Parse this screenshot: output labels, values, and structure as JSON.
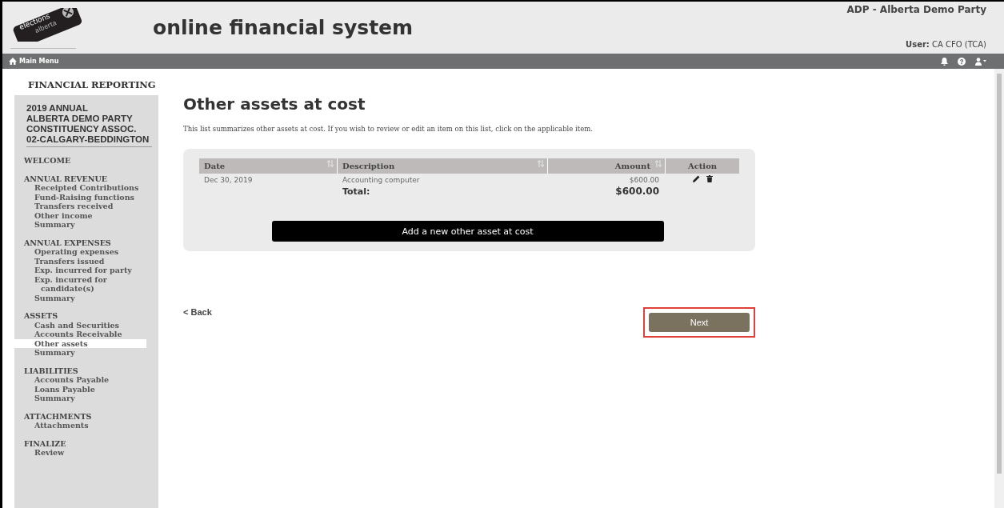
{
  "header": {
    "logo_text": [
      "elections",
      "alberta"
    ],
    "title": "online financial system",
    "organization": "ADP - Alberta Demo Party",
    "user_label": "User:",
    "user_value": "CA CFO (TCA)"
  },
  "nav": {
    "main_menu": "Main Menu"
  },
  "sidebar": {
    "title": "FINANCIAL REPORTING",
    "report_lines": [
      "2019 ANNUAL",
      "ALBERTA DEMO PARTY",
      "CONSTITUENCY ASSOC.",
      "02-CALGARY-BEDDINGTON"
    ],
    "sections": [
      {
        "heading": "WELCOME"
      },
      {
        "heading": "ANNUAL REVENUE",
        "items": [
          {
            "label": "Receipted Contributions",
            "selected": false
          },
          {
            "label": "Fund-Raising functions",
            "selected": false
          },
          {
            "label": "Transfers received",
            "selected": false
          },
          {
            "label": "Other income",
            "selected": false
          },
          {
            "label": "Summary",
            "selected": false
          }
        ]
      },
      {
        "heading": "ANNUAL EXPENSES",
        "items": [
          {
            "label": "Operating expenses",
            "selected": false
          },
          {
            "label": "Transfers issued",
            "selected": false
          },
          {
            "label": "Exp. incurred for party",
            "selected": false
          },
          {
            "label": "Exp. incurred for candidate(s)",
            "selected": false
          },
          {
            "label": "Summary",
            "selected": false
          }
        ]
      },
      {
        "heading": "ASSETS",
        "items": [
          {
            "label": "Cash and Securities",
            "selected": false
          },
          {
            "label": "Accounts Receivable",
            "selected": false
          },
          {
            "label": "Other assets",
            "selected": true
          },
          {
            "label": "Summary",
            "selected": false
          }
        ]
      },
      {
        "heading": "LIABILITIES",
        "items": [
          {
            "label": "Accounts Payable",
            "selected": false
          },
          {
            "label": "Loans Payable",
            "selected": false
          },
          {
            "label": "Summary",
            "selected": false
          }
        ]
      },
      {
        "heading": "ATTACHMENTS",
        "items": [
          {
            "label": "Attachments",
            "selected": false
          }
        ]
      },
      {
        "heading": "FINALIZE",
        "items": [
          {
            "label": "Review",
            "selected": false
          }
        ]
      }
    ]
  },
  "page": {
    "title": "Other assets at cost",
    "intro": "This list summarizes other assets at cost. If you wish to review or edit an item on this list, click on the applicable item.",
    "table": {
      "columns": [
        "Date",
        "Description",
        "Amount",
        "Action"
      ],
      "rows": [
        {
          "date": "Dec 30, 2019",
          "description": "Accounting computer",
          "amount": "$600.00"
        }
      ],
      "total_label": "Total:",
      "total_amount": "$600.00"
    },
    "add_button": "Add a new other asset at cost",
    "back_link": "< Back",
    "next_button": {
      "label": "Next",
      "highlighted": true
    }
  }
}
